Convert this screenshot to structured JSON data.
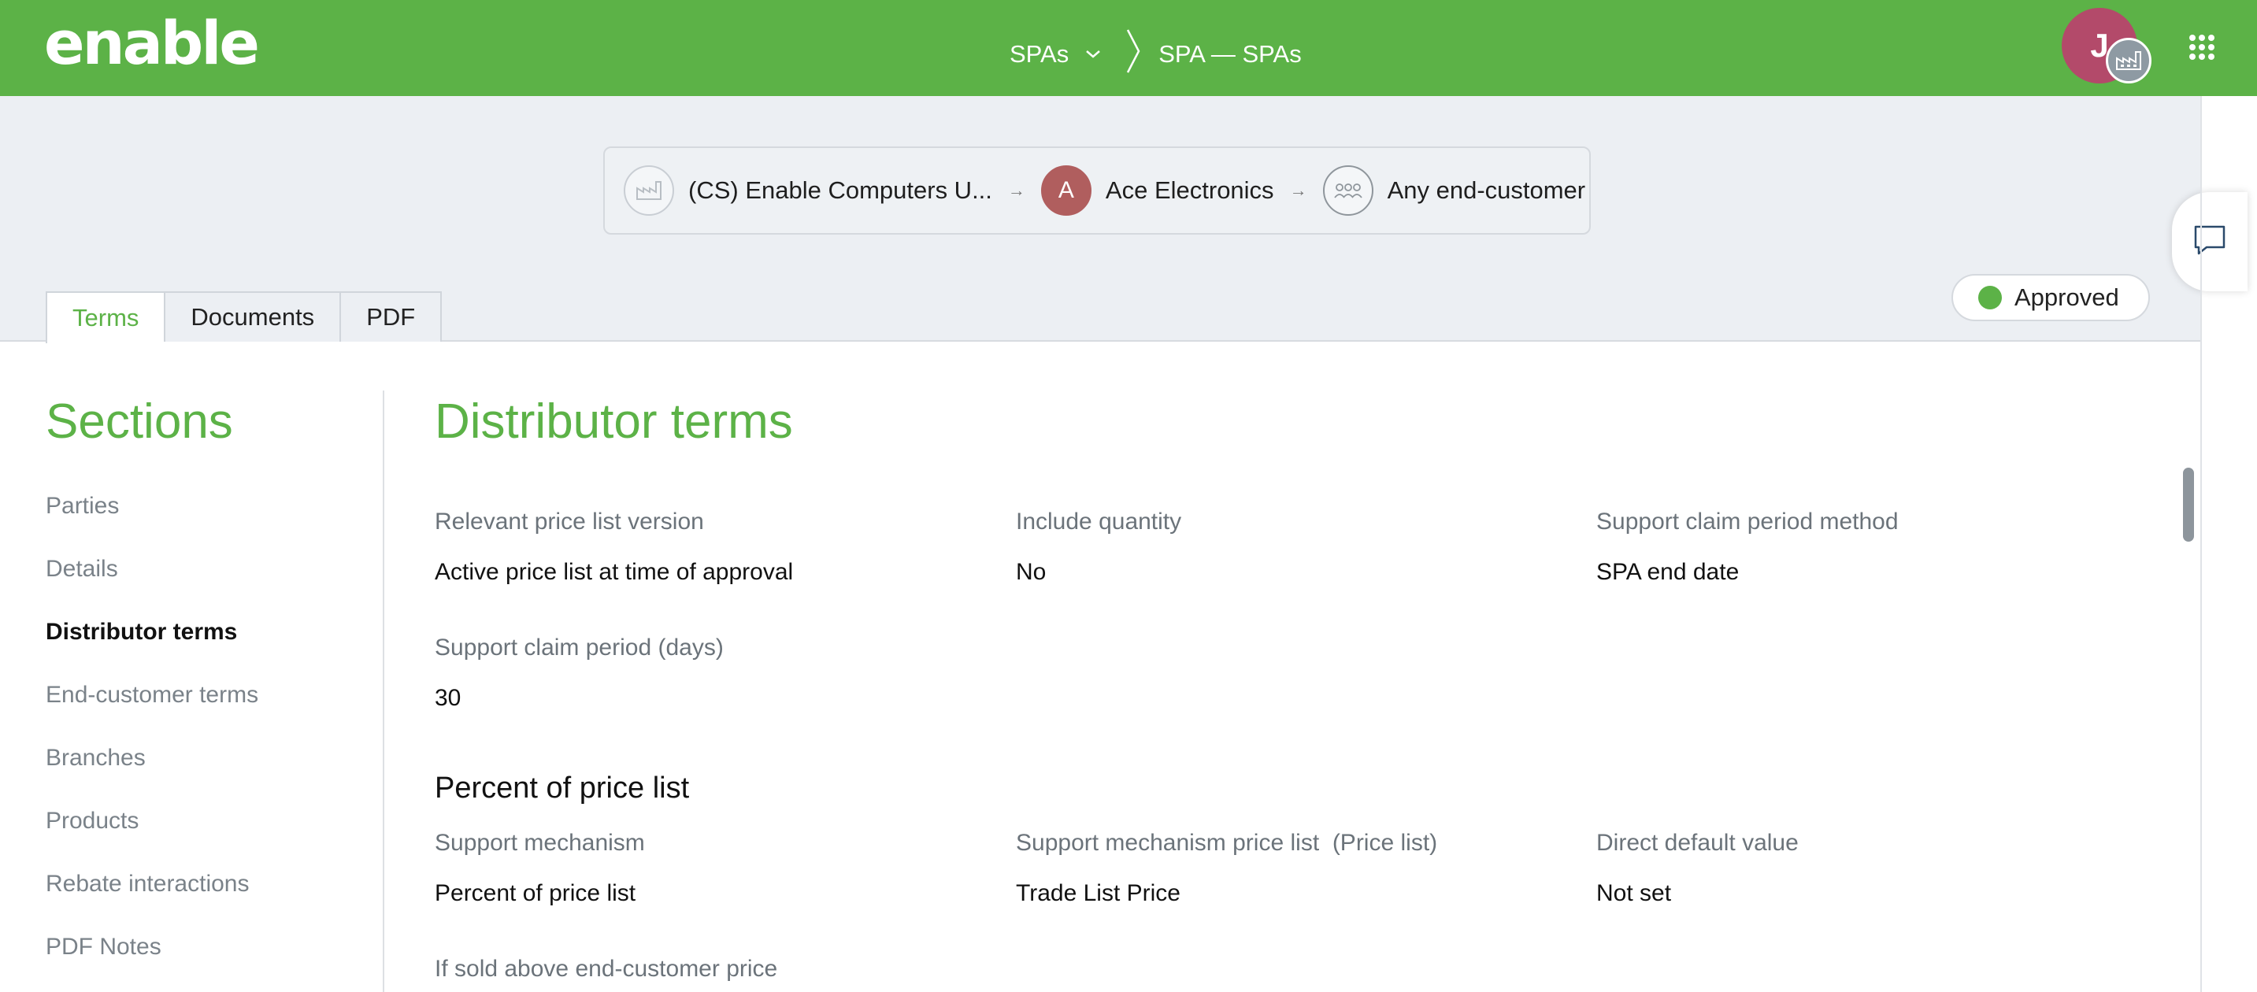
{
  "header": {
    "logo": "enable",
    "breadcrumb_root": "SPAs",
    "breadcrumb_current": "SPA — SPAs",
    "avatar_initial": "J"
  },
  "parties": {
    "distributor": "(CS) Enable Computers U...",
    "reseller_initial": "A",
    "reseller": "Ace Electronics",
    "end_customer": "Any end-customer"
  },
  "tabs": [
    {
      "label": "Terms",
      "active": true
    },
    {
      "label": "Documents",
      "active": false
    },
    {
      "label": "PDF",
      "active": false
    }
  ],
  "status": {
    "label": "Approved",
    "color": "#5cb247"
  },
  "sidebar": {
    "title": "Sections",
    "items": [
      {
        "label": "Parties"
      },
      {
        "label": "Details"
      },
      {
        "label": "Distributor terms",
        "active": true
      },
      {
        "label": "End-customer terms"
      },
      {
        "label": "Branches"
      },
      {
        "label": "Products"
      },
      {
        "label": "Rebate interactions"
      },
      {
        "label": "PDF Notes"
      }
    ]
  },
  "main": {
    "title": "Distributor terms",
    "fields": [
      {
        "label": "Relevant price list version",
        "value": "Active price list at time of approval"
      },
      {
        "label": "Include quantity",
        "value": "No"
      },
      {
        "label": "Support claim period method",
        "value": "SPA end date"
      },
      {
        "label": "Support claim period (days)",
        "value": "30"
      }
    ],
    "subsection_title": "Percent of price list",
    "subsection_fields": [
      {
        "label": "Support mechanism",
        "value": "Percent of price list"
      },
      {
        "label": "Support mechanism price list  (Price list)",
        "value": "Trade List Price"
      },
      {
        "label": "Direct default value",
        "value": "Not set"
      },
      {
        "label": "If sold above end-customer price",
        "value": ""
      }
    ]
  },
  "colors": {
    "brand_green": "#5cb247",
    "band_gray": "#eceff3"
  }
}
